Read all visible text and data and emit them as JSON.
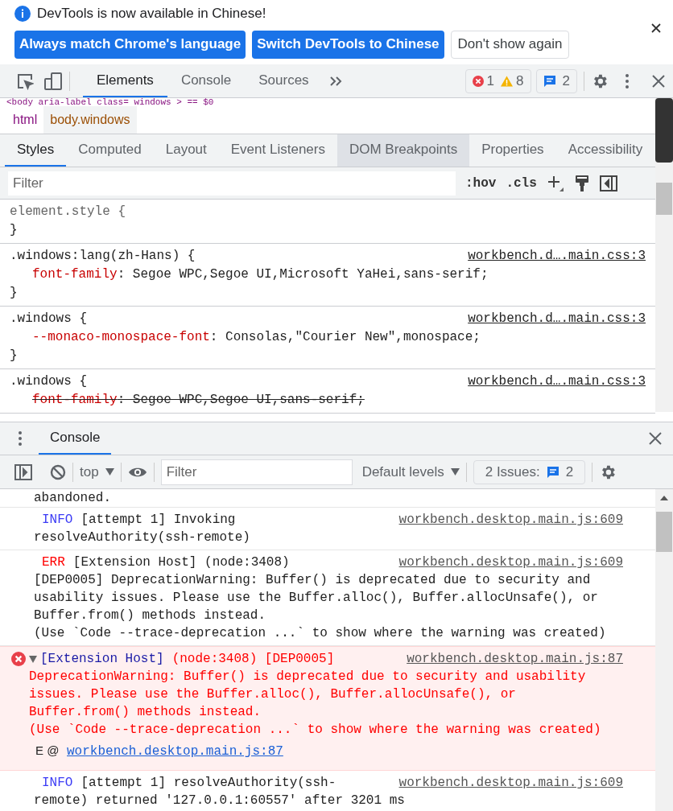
{
  "banner": {
    "message": "DevTools is now available in Chinese!",
    "buttons": [
      {
        "label": "Always match Chrome's language",
        "kind": "primary"
      },
      {
        "label": "Switch DevTools to Chinese",
        "kind": "primary"
      },
      {
        "label": "Don't show again",
        "kind": "secondary"
      }
    ]
  },
  "toolbar": {
    "tabs": [
      {
        "label": "Elements",
        "selected": true
      },
      {
        "label": "Console",
        "selected": false
      },
      {
        "label": "Sources",
        "selected": false
      }
    ],
    "errors": "1",
    "warnings": "8",
    "messages": "2"
  },
  "dom_line": "<body aria-label class= windows > == $0",
  "breadcrumbs": [
    {
      "label": "html",
      "selected": false
    },
    {
      "label": "body.windows",
      "selected": true
    }
  ],
  "styles_tabs": [
    {
      "label": "Styles",
      "selected": true,
      "highlighted": false
    },
    {
      "label": "Computed",
      "selected": false,
      "highlighted": false
    },
    {
      "label": "Layout",
      "selected": false,
      "highlighted": false
    },
    {
      "label": "Event Listeners",
      "selected": false,
      "highlighted": false
    },
    {
      "label": "DOM Breakpoints",
      "selected": false,
      "highlighted": true
    },
    {
      "label": "Properties",
      "selected": false,
      "highlighted": false
    },
    {
      "label": "Accessibility",
      "selected": false,
      "highlighted": false
    }
  ],
  "styles_filter": {
    "placeholder": "Filter",
    "hov": ":hov",
    "cls": ".cls"
  },
  "rules": [
    {
      "kind": "inline",
      "selector": "element.style {",
      "close": "}"
    },
    {
      "kind": "rule",
      "selector": ".windows:lang(zh-Hans) {",
      "source": "workbench.d….main.css:3",
      "close": "}",
      "declarations": [
        {
          "property": "font-family",
          "value": ": Segoe WPC,Segoe UI,Microsoft YaHei,sans-serif;",
          "struck": false
        }
      ]
    },
    {
      "kind": "rule",
      "selector": ".windows {",
      "source": "workbench.d….main.css:3",
      "close": "}",
      "declarations": [
        {
          "property": "--monaco-monospace-font",
          "value": ": Consolas,\"Courier New\",monospace;",
          "struck": false
        }
      ]
    },
    {
      "kind": "rule",
      "selector": ".windows {",
      "source": "workbench.d….main.css:3",
      "declarations": [
        {
          "property": "font-family",
          "value": ": Segoe WPC,Segoe UI,sans-serif;",
          "struck": true
        }
      ]
    }
  ],
  "drawer": {
    "tab": "Console",
    "context": "top",
    "filter_placeholder": "Filter",
    "levels": "Default levels",
    "issues": "2 Issues:",
    "issues_count": "2"
  },
  "messages": [
    {
      "kind": "text",
      "lines": [
        "abandoned."
      ]
    },
    {
      "kind": "info",
      "level": "INFO",
      "lines": [
        "[attempt 1] Invoking",
        "resolveAuthority(ssh-remote)"
      ],
      "source": "workbench.desktop.main.js:609"
    },
    {
      "kind": "err",
      "level": "ERR",
      "lines": [
        "[Extension Host] (node:3408)",
        "[DEP0005] DeprecationWarning: Buffer() is deprecated due to security and usability issues. Please use the Buffer.alloc(), Buffer.allocUnsafe(), or Buffer.from() methods instead.\n(Use `Code --trace-deprecation ...` to show where the warning was created)"
      ],
      "source": "workbench.desktop.main.js:609"
    },
    {
      "kind": "error",
      "prefix": "[Extension Host]",
      "lines": [
        "(node:3408) [DEP0005]",
        "DeprecationWarning: Buffer() is deprecated due to security and usability issues. Please use the Buffer.alloc(), Buffer.allocUnsafe(), or Buffer.from() methods instead.\n(Use `Code --trace-deprecation ...` to show where the warning was created)"
      ],
      "source": "workbench.desktop.main.js:87",
      "stack_prefix": "E @",
      "stack_link": "workbench.desktop.main.js:87"
    },
    {
      "kind": "info",
      "level": "INFO",
      "lines": [
        "[attempt 1] resolveAuthority(ssh-",
        "remote) returned '127.0.0.1:60557' after 3201 ms"
      ],
      "source": "workbench.desktop.main.js:609"
    }
  ]
}
